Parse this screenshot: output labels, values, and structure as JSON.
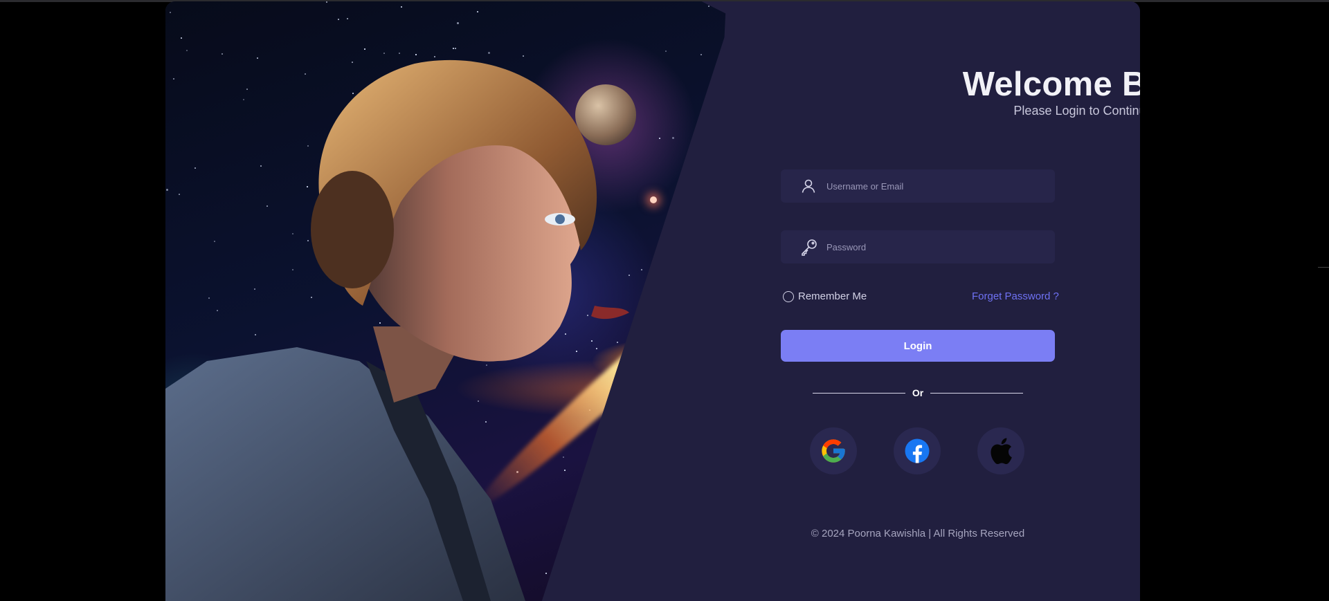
{
  "login": {
    "title": "Welcome Back",
    "subtitle": "Please Login to Continue",
    "username_placeholder": "Username or Email",
    "password_placeholder": "Password",
    "remember_label": "Remember Me",
    "forgot_label": "Forget Password ?",
    "login_button": "Login",
    "divider_label": "Or"
  },
  "social": [
    {
      "name": "google",
      "icon": "google-icon"
    },
    {
      "name": "facebook",
      "icon": "facebook-icon"
    },
    {
      "name": "apple",
      "icon": "apple-icon"
    }
  ],
  "footer": {
    "text": "© 2024 Poorna Kawishla | All Rights Reserved"
  },
  "colors": {
    "background": "#000000",
    "card": "#211f3f",
    "field": "#27254a",
    "accent": "#7b7ef4",
    "link": "#6f72f4"
  }
}
